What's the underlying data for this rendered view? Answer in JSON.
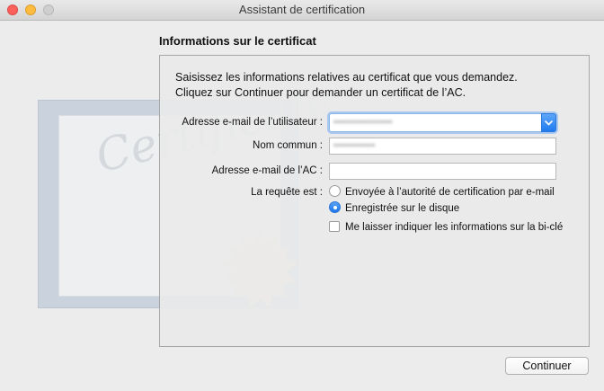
{
  "window": {
    "title": "Assistant de certification"
  },
  "section_title": "Informations sur le certificat",
  "intro": {
    "line1": "Saisissez les informations relatives au certificat que vous demandez.",
    "line2": "Cliquez sur Continuer pour demander un certificat de l’AC."
  },
  "decoration": {
    "certificate_word": "Certificate"
  },
  "form": {
    "user_email_label": "Adresse e-mail de l’utilisateur :",
    "user_email_value": "•••••••••••••••••",
    "common_name_label": "Nom commun :",
    "common_name_value": "••••••••••••",
    "ca_email_label": "Adresse e-mail de l’AC :",
    "ca_email_value": "",
    "request_label": "La requête est :",
    "option_email": "Envoyée à l’autorité de certification par e-mail",
    "option_disk": "Enregistrée sur le disque",
    "option_selected": "Enregistrée sur le disque",
    "keypair_checkbox": "Me laisser indiquer les informations sur la bi-clé",
    "keypair_checked": false
  },
  "buttons": {
    "continue": "Continuer"
  },
  "colors": {
    "accent": "#1e7bf0",
    "close": "#fc605b",
    "minimize": "#fdbc40"
  }
}
